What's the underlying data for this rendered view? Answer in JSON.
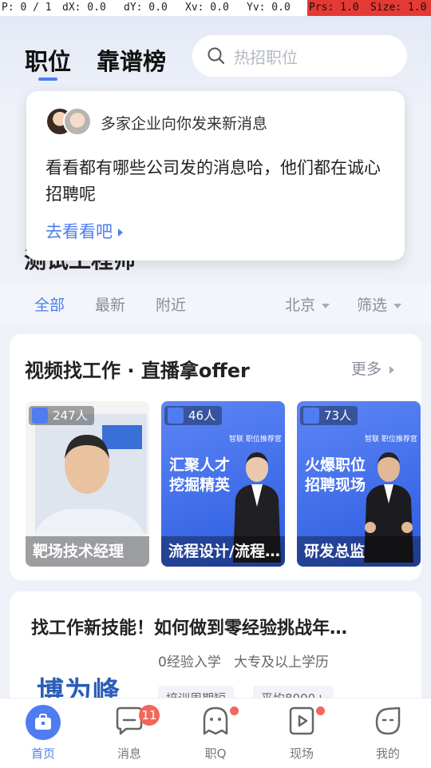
{
  "debug": {
    "pointer": "P: 0 / 1",
    "dx": "dX: 0.0",
    "dy": "dY: 0.0",
    "xv": "Xv: 0.0",
    "yv": "Yv: 0.0",
    "prs": "Prs: 1.0",
    "size": "Size: 1.0"
  },
  "header": {
    "tab_jobs": "职位",
    "tab_ranking": "靠谱榜",
    "search_placeholder": "热招职位"
  },
  "popup": {
    "title": "多家企业向你发来新消息",
    "body": "看看都有哪些公司发的消息哈，他们都在诚心招聘呢",
    "link": "去看看吧"
  },
  "section_title": "测试工程师",
  "filters": {
    "all": "全部",
    "latest": "最新",
    "nearby": "附近",
    "city": "北京",
    "screen": "筛选"
  },
  "video_section": {
    "title": "视频找工作 · 直播拿offer",
    "more": "更多",
    "items": [
      {
        "viewers": "247人",
        "caption": "靶场技术经理"
      },
      {
        "viewers": "46人",
        "caption": "流程设计/流程…",
        "slogan_1": "汇聚人才",
        "slogan_2": "挖掘精英",
        "brand": "智联 职位推荐官"
      },
      {
        "viewers": "73人",
        "caption": "研发总监",
        "slogan_1": "火爆职位",
        "slogan_2": "招聘现场",
        "brand": "智联 职位推荐官"
      }
    ]
  },
  "course": {
    "title": "找工作新技能！如何做到零经验挑战年…",
    "info_1": "0经验入学",
    "info_2": "大专及以上学历",
    "logo": "博为峰",
    "tag_1": "培训周期短",
    "tag_2": "平均8000+"
  },
  "nav": {
    "home": "首页",
    "messages": "消息",
    "messages_badge": "11",
    "zhiq": "职Q",
    "live": "现场",
    "mine": "我的"
  },
  "colors": {
    "accent": "#4f7cf0",
    "badge": "#f2665b",
    "debug_red": "#e53935"
  }
}
